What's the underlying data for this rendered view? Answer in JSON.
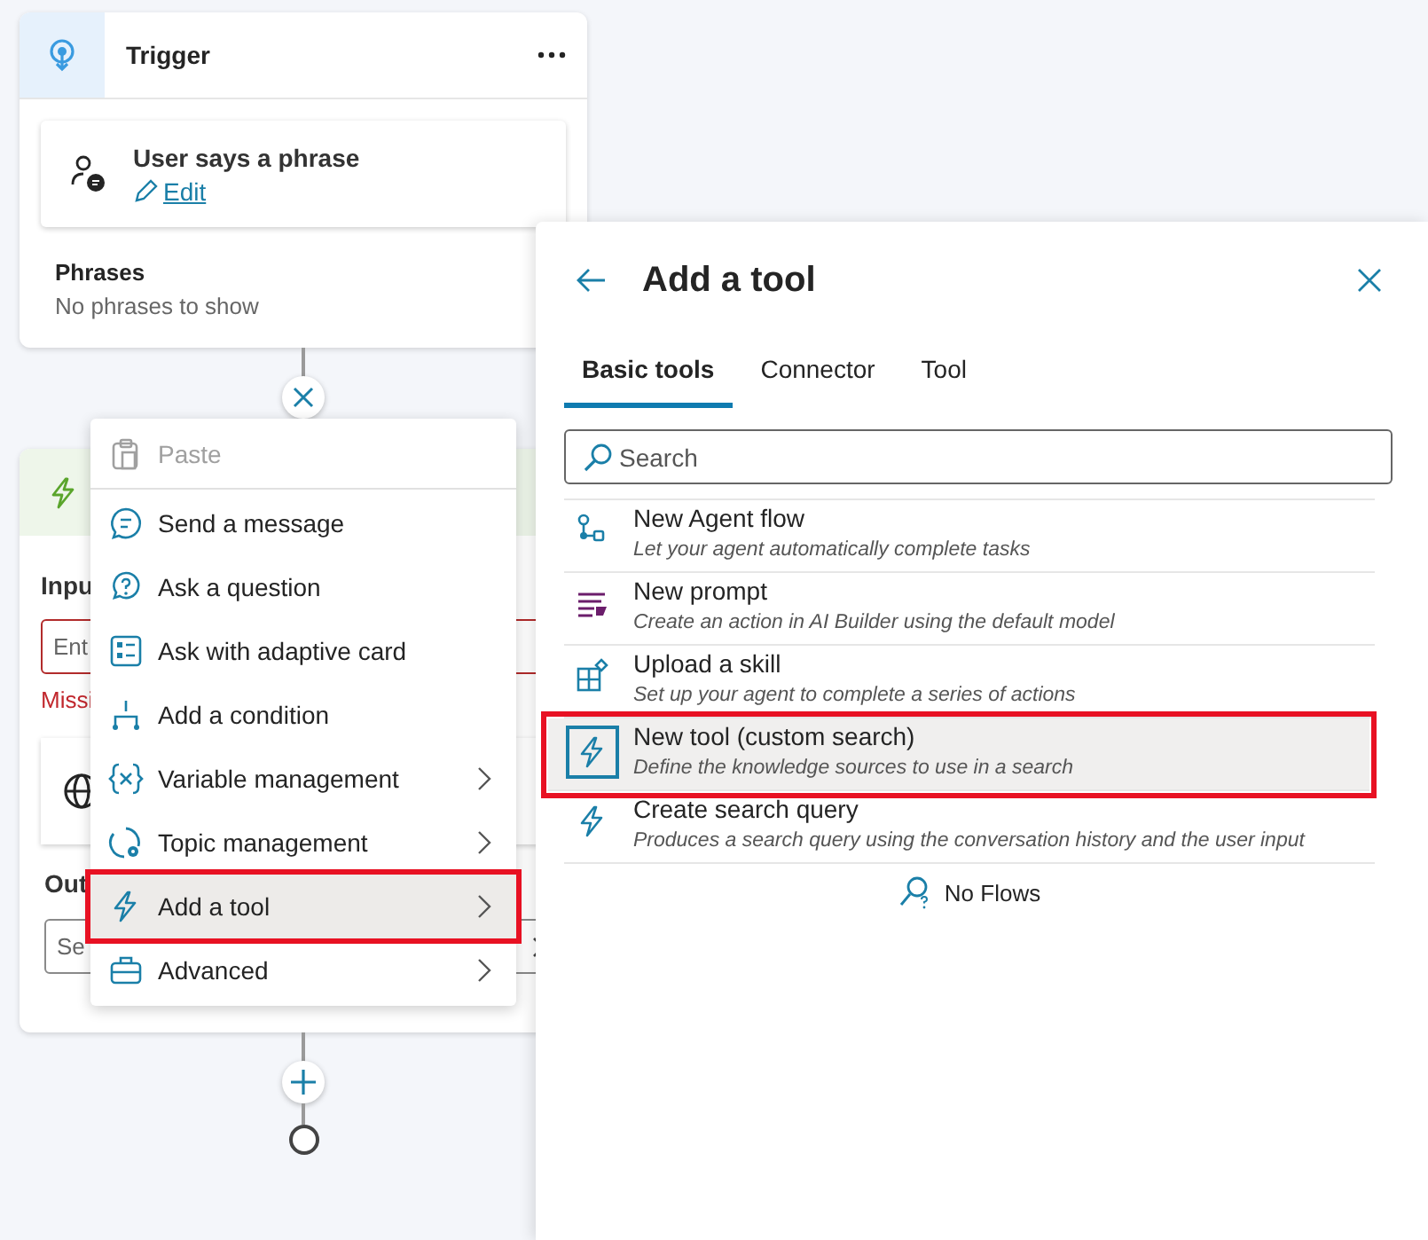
{
  "trigger_node": {
    "title": "Trigger",
    "trigger_label": "User says a phrase",
    "edit_link": "Edit",
    "phrases_heading": "Phrases",
    "phrases_empty": "No phrases to show"
  },
  "action_node": {
    "input_label": "Inpu",
    "input_placeholder": "Ent",
    "error_text": "Missi",
    "output_label": "Out",
    "output_value": "Se"
  },
  "context_menu": {
    "items": [
      {
        "label": "Paste",
        "disabled": true,
        "selected": false,
        "highlighted": false,
        "submenu": false
      },
      {
        "label": "Send a message",
        "disabled": false,
        "selected": false,
        "highlighted": false,
        "submenu": false
      },
      {
        "label": "Ask a question",
        "disabled": false,
        "selected": false,
        "highlighted": false,
        "submenu": false
      },
      {
        "label": "Ask with adaptive card",
        "disabled": false,
        "selected": false,
        "highlighted": false,
        "submenu": false
      },
      {
        "label": "Add a condition",
        "disabled": false,
        "selected": false,
        "highlighted": false,
        "submenu": false
      },
      {
        "label": "Variable management",
        "disabled": false,
        "selected": false,
        "highlighted": false,
        "submenu": true
      },
      {
        "label": "Topic management",
        "disabled": false,
        "selected": false,
        "highlighted": false,
        "submenu": true
      },
      {
        "label": "Add a tool",
        "disabled": false,
        "selected": true,
        "highlighted": true,
        "submenu": true
      },
      {
        "label": "Advanced",
        "disabled": false,
        "selected": false,
        "highlighted": false,
        "submenu": true
      }
    ]
  },
  "tool_panel": {
    "title": "Add a tool",
    "tabs": [
      {
        "label": "Basic tools",
        "selected": true
      },
      {
        "label": "Connector",
        "selected": false
      },
      {
        "label": "Tool",
        "selected": false
      }
    ],
    "search": {
      "placeholder": "Search"
    },
    "tools": [
      {
        "name": "New Agent flow",
        "description": "Let your agent automatically complete tasks",
        "selected": false,
        "highlighted": false
      },
      {
        "name": "New prompt",
        "description": "Create an action in AI Builder using the default model",
        "selected": false,
        "highlighted": false
      },
      {
        "name": "Upload a skill",
        "description": "Set up your agent to complete a series of actions",
        "selected": false,
        "highlighted": false
      },
      {
        "name": "New tool (custom search)",
        "description": "Define the knowledge sources to use in a search",
        "selected": true,
        "highlighted": true
      },
      {
        "name": "Create search query",
        "description": "Produces a search query using the conversation history and the user input",
        "selected": false,
        "highlighted": false
      }
    ],
    "empty_text": "No Flows"
  }
}
